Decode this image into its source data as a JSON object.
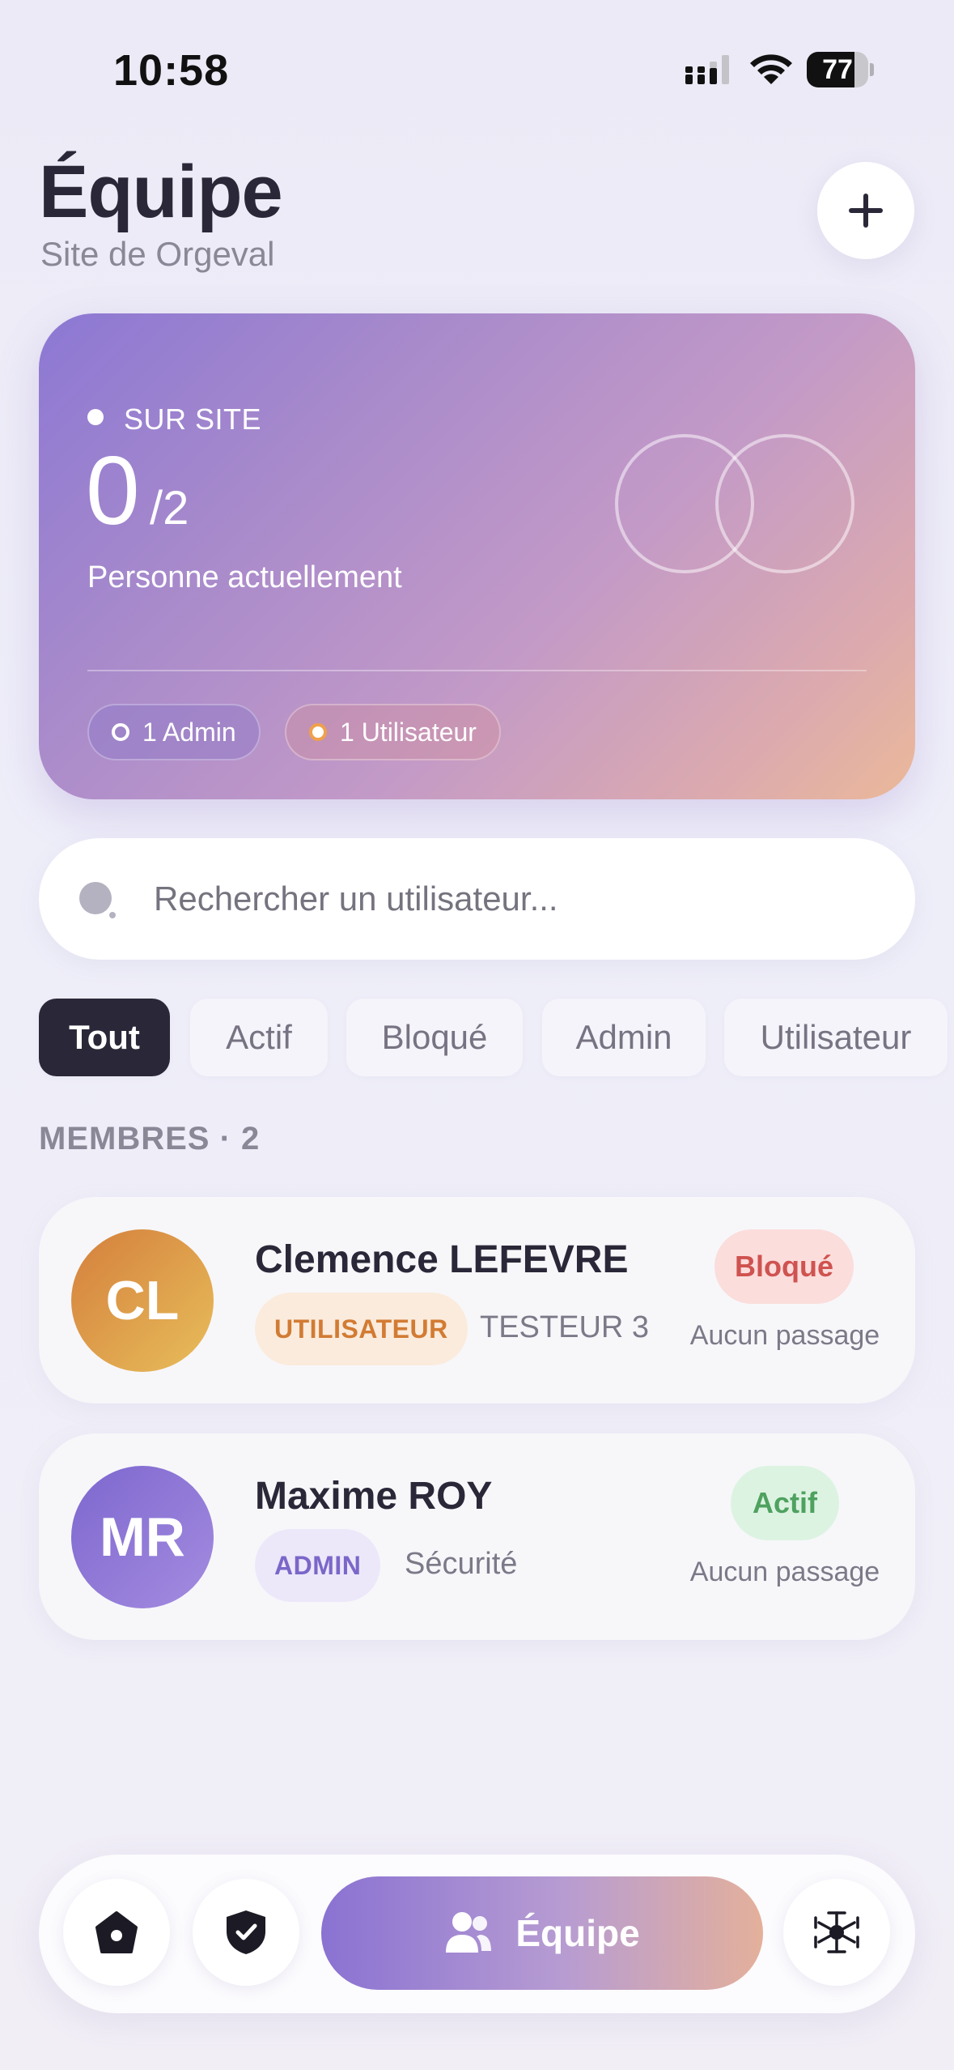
{
  "status_bar": {
    "time": "10:58",
    "battery": "77",
    "battery_level": 0.77
  },
  "header": {
    "title": "Équipe",
    "subtitle": "Site de Orgeval",
    "add_icon": "plus-icon"
  },
  "hero": {
    "live_label": "SUR SITE",
    "count": "0",
    "total": "/2",
    "caption": "Personne actuellement",
    "chips": [
      {
        "label": "1 Admin"
      },
      {
        "label": "1 Utilisateur"
      }
    ]
  },
  "search": {
    "placeholder": "Rechercher un utilisateur...",
    "value": ""
  },
  "filters": [
    {
      "label": "Tout",
      "active": true
    },
    {
      "label": "Actif",
      "active": false
    },
    {
      "label": "Bloqué",
      "active": false
    },
    {
      "label": "Admin",
      "active": false
    },
    {
      "label": "Utilisateur",
      "active": false
    }
  ],
  "section": {
    "title": "MEMBRES · 2"
  },
  "members": [
    {
      "initials": "CL",
      "name": "Clemence LEFEVRE",
      "role": "UTILISATEUR",
      "team": "TESTEUR 3",
      "status": "Bloqué",
      "last_passage": "Aucun passage"
    },
    {
      "initials": "MR",
      "name": "Maxime ROY",
      "role": "ADMIN",
      "team": "Sécurité",
      "status": "Actif",
      "last_passage": "Aucun passage"
    }
  ],
  "bottom_nav": {
    "items": [
      {
        "icon": "home-icon"
      },
      {
        "icon": "shield-check-icon"
      },
      {
        "icon": "team-icon",
        "label": "Équipe",
        "active": true
      },
      {
        "icon": "network-icon"
      }
    ]
  },
  "colors": {
    "accent_dark": "#2a2838",
    "blocked": "#cf5350",
    "active": "#4ea25f",
    "user_badge": "#d27b33",
    "admin_badge": "#7b67c9"
  }
}
